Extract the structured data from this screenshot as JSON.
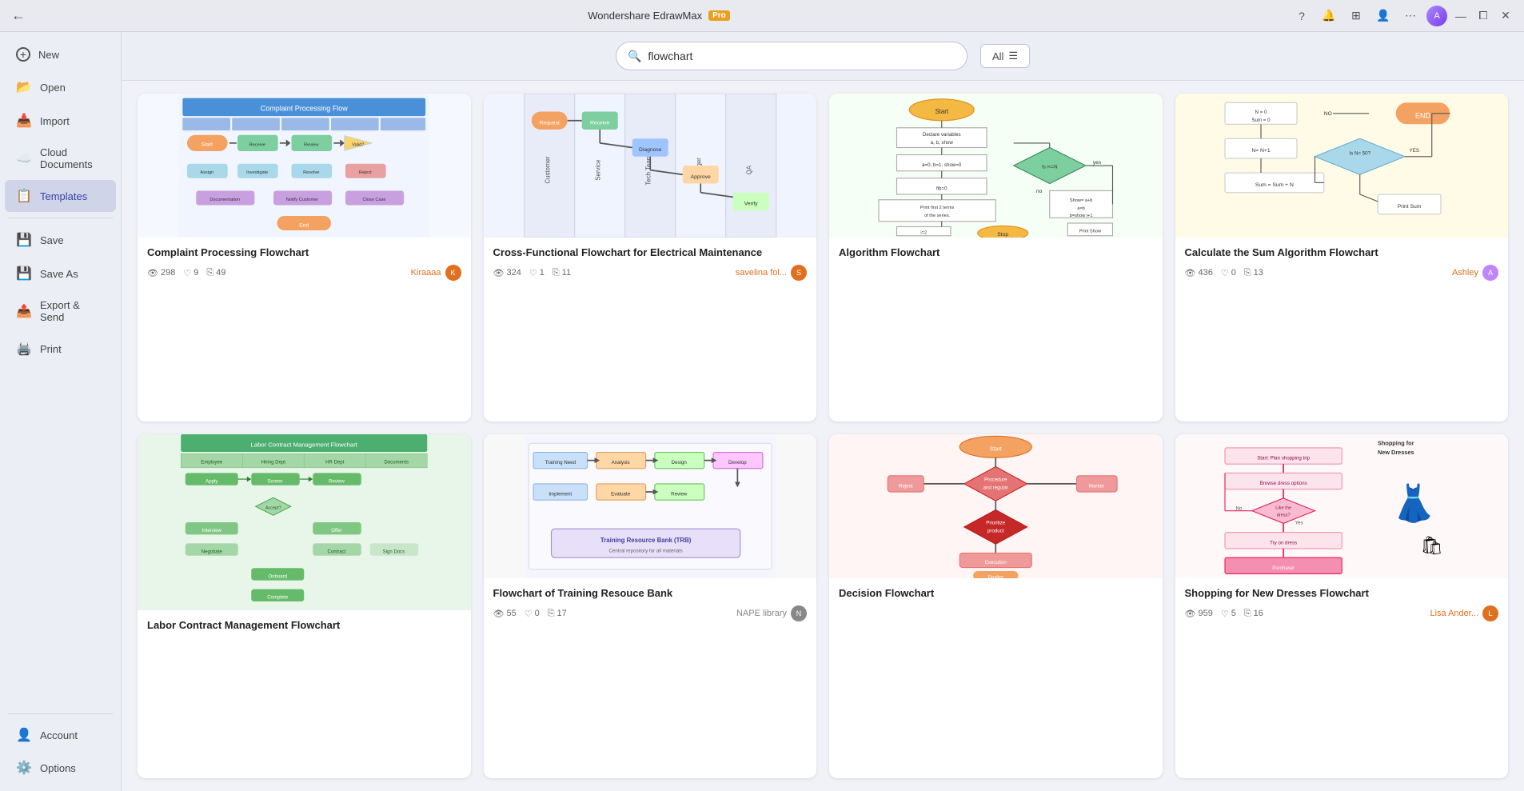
{
  "titlebar": {
    "title": "Wondershare EdrawMax",
    "pro_badge": "Pro",
    "controls": {
      "minimize": "—",
      "maximize": "⧠",
      "close": "✕"
    },
    "right_icons": [
      "?",
      "🔔",
      "⊞",
      "👤",
      "⋯"
    ]
  },
  "search": {
    "value": "flowchart",
    "placeholder": "flowchart",
    "filter_label": "All"
  },
  "sidebar": {
    "items": [
      {
        "id": "new",
        "label": "New",
        "icon": "+"
      },
      {
        "id": "open",
        "label": "Open",
        "icon": "📂"
      },
      {
        "id": "import",
        "label": "Import",
        "icon": "📥"
      },
      {
        "id": "cloud",
        "label": "Cloud Documents",
        "icon": "☁️"
      },
      {
        "id": "templates",
        "label": "Templates",
        "icon": "📋"
      },
      {
        "id": "save",
        "label": "Save",
        "icon": "💾"
      },
      {
        "id": "saveas",
        "label": "Save As",
        "icon": "💾"
      },
      {
        "id": "export",
        "label": "Export & Send",
        "icon": "📤"
      },
      {
        "id": "print",
        "label": "Print",
        "icon": "🖨️"
      }
    ],
    "bottom_items": [
      {
        "id": "account",
        "label": "Account",
        "icon": "👤"
      },
      {
        "id": "options",
        "label": "Options",
        "icon": "⚙️"
      }
    ]
  },
  "cards": [
    {
      "id": "card-complaint",
      "title": "Complaint Processing Flowchart",
      "views": "298",
      "likes": "9",
      "copies": "49",
      "author_name": "Kiraaaa",
      "author_color": "#e07020",
      "bg": "#f5f8ff"
    },
    {
      "id": "card-cross-functional",
      "title": "Cross-Functional Flowchart for Electrical Maintenance",
      "views": "324",
      "likes": "1",
      "copies": "11",
      "author_name": "savelina fol...",
      "author_color": "#e07020",
      "bg": "#f0f4ff"
    },
    {
      "id": "card-training",
      "title": "Flowchart of Training Resouce Bank",
      "views": "55",
      "likes": "0",
      "copies": "17",
      "author_name": "NAPE library",
      "author_color": "#888",
      "bg": "#f5f5ff"
    },
    {
      "id": "card-algorithm",
      "title": "Algorithm Flowchart",
      "views": "",
      "likes": "",
      "copies": "",
      "author_name": "",
      "author_color": "#888",
      "bg": "#f5fff5"
    },
    {
      "id": "card-labor",
      "title": "Labor Contract Management Flowchart",
      "views": "",
      "likes": "",
      "copies": "",
      "author_name": "",
      "author_color": "#888",
      "bg": "#e8f5e9"
    },
    {
      "id": "card-decision",
      "title": "Decision Flowchart",
      "views": "",
      "likes": "",
      "copies": "",
      "author_name": "",
      "author_color": "#888",
      "bg": "#fff5f5"
    },
    {
      "id": "card-calc",
      "title": "Calculate the Sum Algorithm Flowchart",
      "views": "436",
      "likes": "0",
      "copies": "13",
      "author_name": "Ashley",
      "author_color": "#e07020",
      "bg": "#fffbe6"
    },
    {
      "id": "card-shopping",
      "title": "Shopping for New Dresses Flowchart",
      "views": "959",
      "likes": "5",
      "copies": "16",
      "author_name": "Lisa Ander...",
      "author_color": "#e07020",
      "bg": "#fff8f8"
    }
  ],
  "icons": {
    "search": "🔍",
    "back": "←",
    "scroll_top": "↑",
    "eye": "👁",
    "heart": "♡",
    "copy": "⎘",
    "filter_chevron": "☰"
  }
}
